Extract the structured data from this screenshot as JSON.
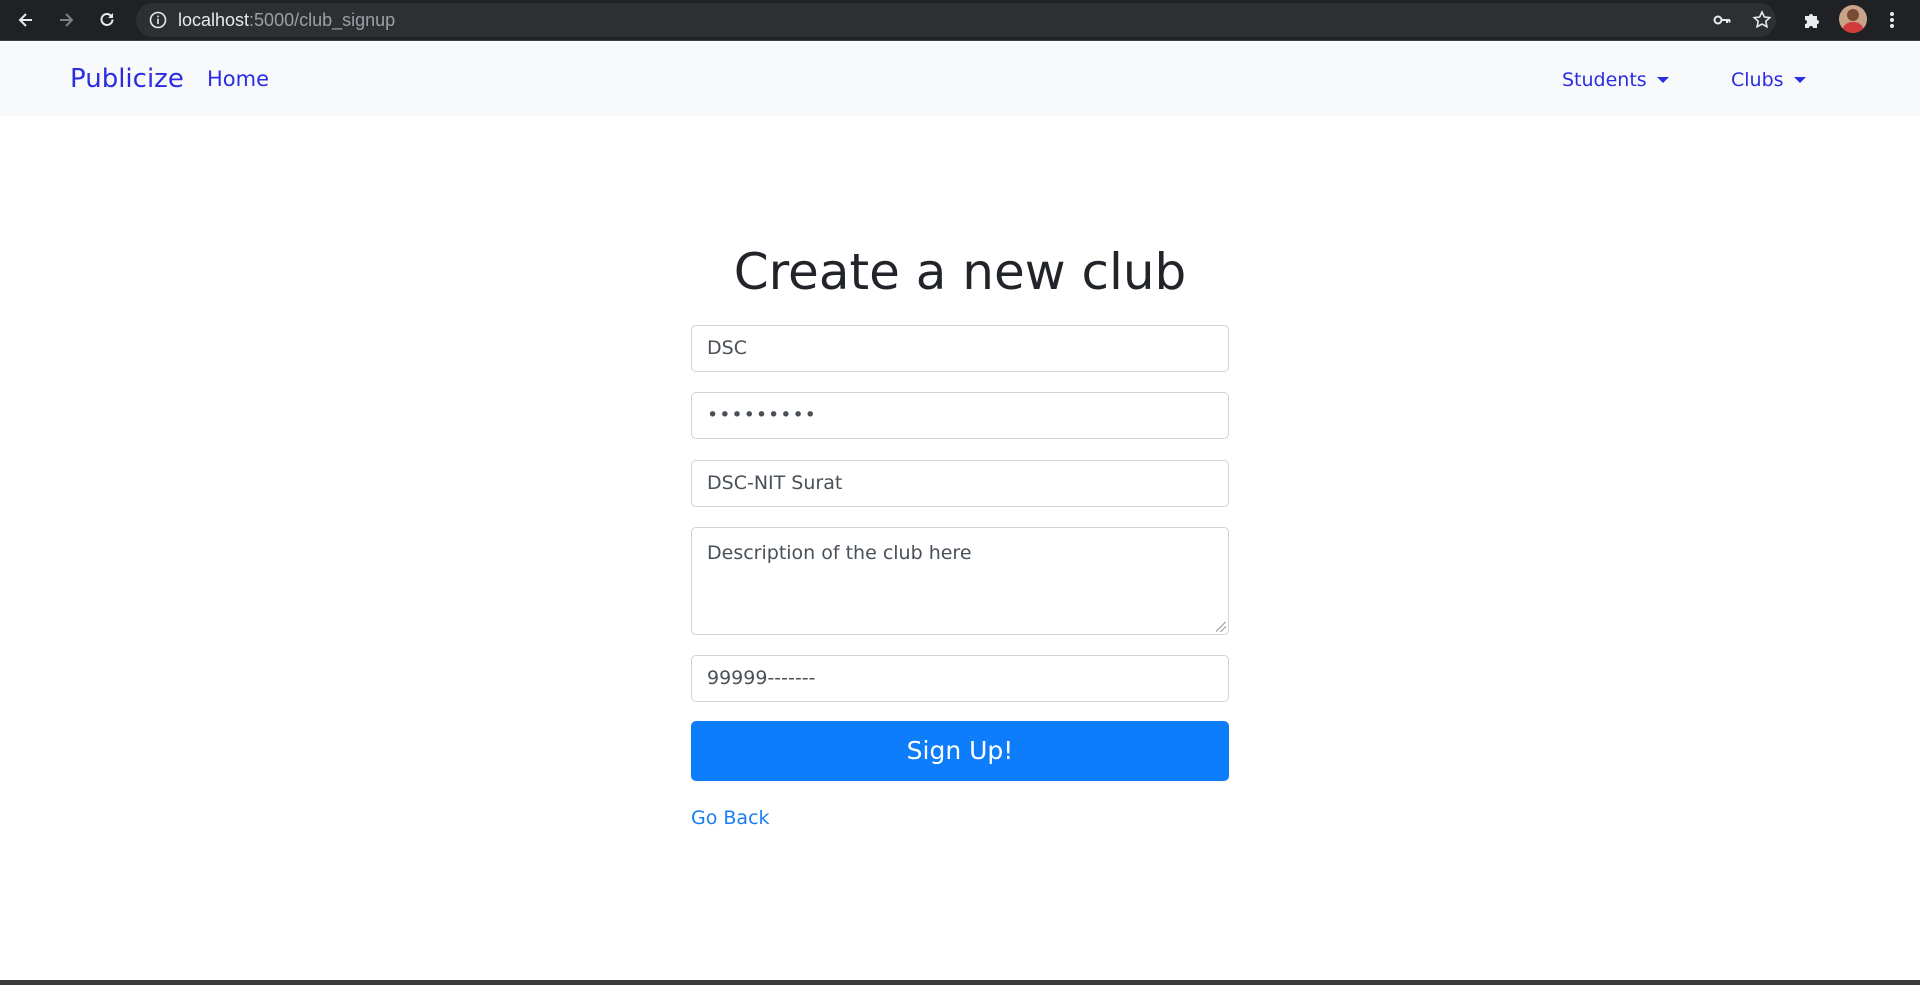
{
  "browser": {
    "url_host": "localhost",
    "url_path": ":5000/club_signup"
  },
  "navbar": {
    "brand": "Publicize",
    "home": "Home",
    "dropdowns": [
      "Students",
      "Clubs"
    ]
  },
  "form": {
    "title": "Create a new club",
    "club_name_value": "DSC",
    "password_mask": "•••••••••",
    "display_name_value": "DSC-NIT Surat",
    "description_value": "Description of the club here",
    "phone_value": "99999-------",
    "submit_label": "Sign Up!",
    "go_back_label": "Go Back"
  },
  "colors": {
    "link": "#2b2de0",
    "primary_button": "#0d7dfb",
    "navbar_bg": "#f8f9fa"
  }
}
